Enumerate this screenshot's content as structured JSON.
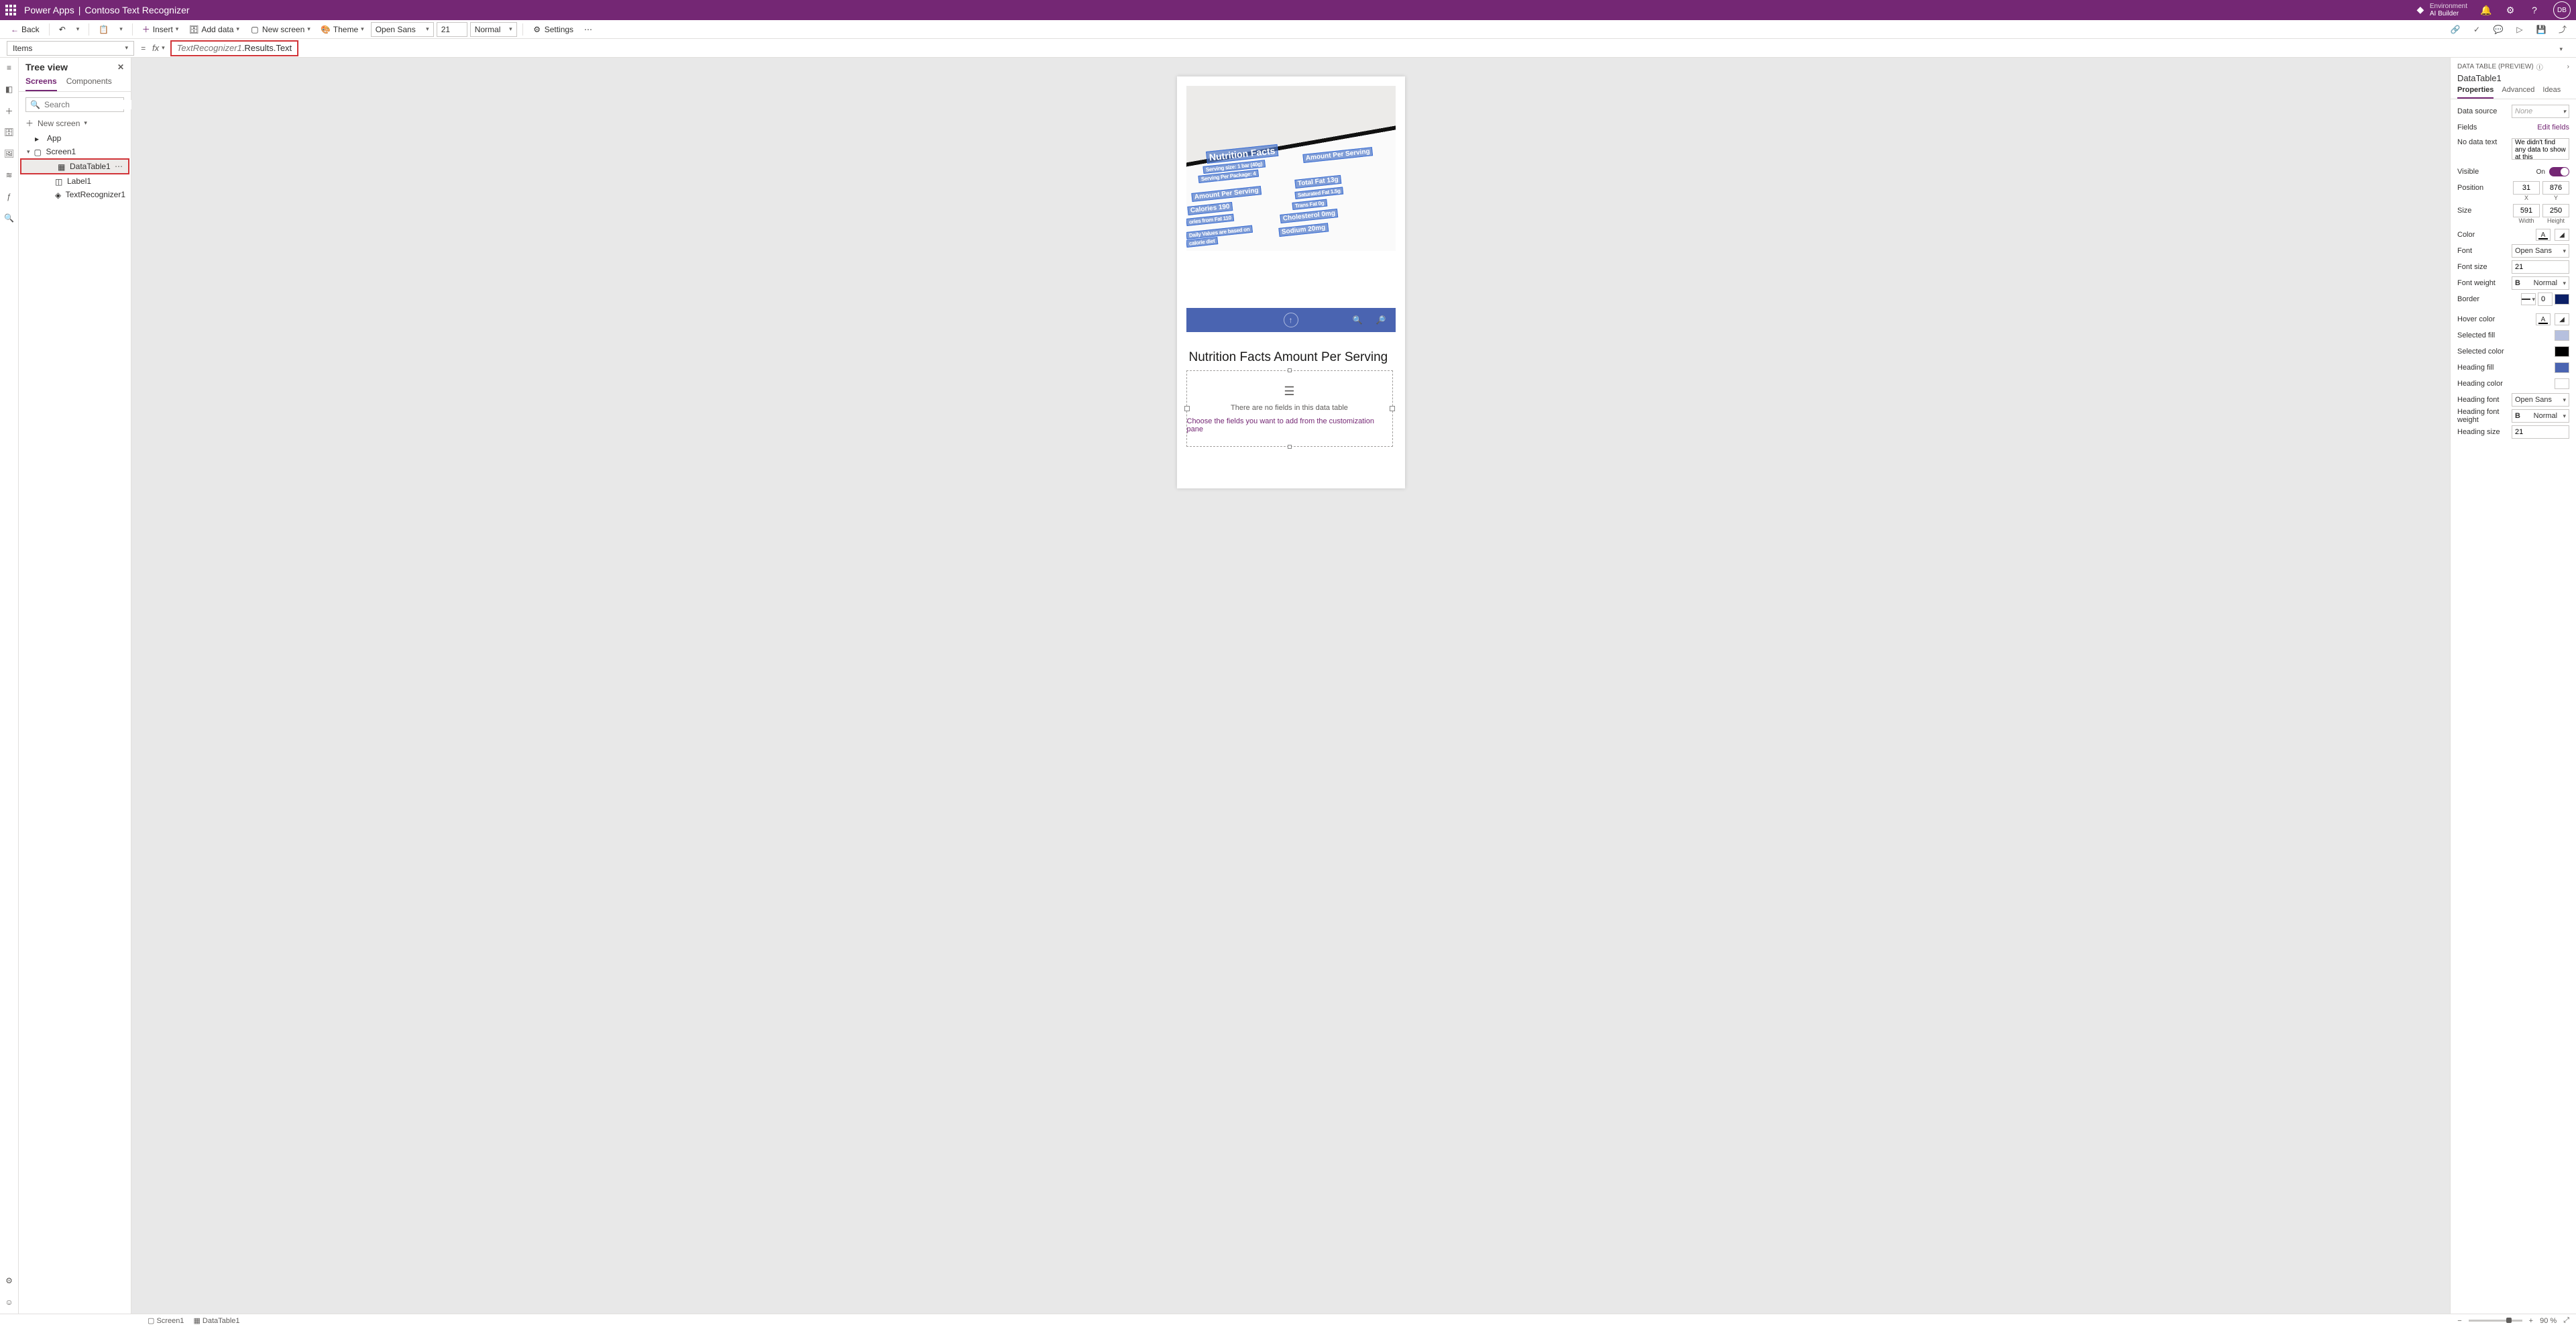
{
  "header": {
    "app_name": "Power Apps",
    "doc_name": "Contoso Text Recognizer",
    "env_label": "Environment",
    "env_value": "AI Builder",
    "avatar_initials": "DB"
  },
  "ribbon": {
    "back": "Back",
    "insert": "Insert",
    "add_data": "Add data",
    "new_screen": "New screen",
    "theme": "Theme",
    "font_family": "Open Sans",
    "font_size": "21",
    "font_weight": "Normal",
    "settings": "Settings"
  },
  "formula": {
    "property": "Items",
    "expr_obj": "TextRecognizer1",
    "expr_tail": ".Results.Text"
  },
  "tree": {
    "title": "Tree view",
    "tab_screens": "Screens",
    "tab_components": "Components",
    "search_placeholder": "Search",
    "new_screen": "New screen",
    "app": "App",
    "screen1": "Screen1",
    "datatable1": "DataTable1",
    "label1": "Label1",
    "textrecognizer1": "TextRecognizer1"
  },
  "canvas": {
    "recognized_labels": {
      "nf": "Nutrition Facts",
      "aps_top": "Amount Per Serving",
      "serving_size": "Serving size: 1 bar (40g)",
      "serving_per_pkg": "Serving Per Package: 4",
      "aps_left": "Amount Per Serving",
      "calories": "Calories 190",
      "from_fat": "ories from Fat 110",
      "daily_values": "Daily Values are based on",
      "calorie_diet": "calorie diet",
      "total_fat": "Total Fat 13g",
      "sat_fat": "Saturated Fat 1.5g",
      "trans_fat": "Trans Fat 0g",
      "cholesterol": "Cholesterol 0mg",
      "sodium": "Sodium 20mg"
    },
    "label_text": "Nutrition Facts Amount Per Serving",
    "datatable_empty_line1": "There are no fields in this data table",
    "datatable_empty_line2": "Choose the fields you want to add from the customization pane"
  },
  "props": {
    "heading": "DATA TABLE (PREVIEW)",
    "element_name": "DataTable1",
    "tab_properties": "Properties",
    "tab_advanced": "Advanced",
    "tab_ideas": "Ideas",
    "data_source_label": "Data source",
    "data_source_value": "None",
    "fields_label": "Fields",
    "edit_fields": "Edit fields",
    "no_data_label": "No data text",
    "no_data_value": "We didn't find any data to show at this",
    "visible_label": "Visible",
    "visible_on": "On",
    "position_label": "Position",
    "pos_x": "31",
    "pos_y": "876",
    "pos_x_lbl": "X",
    "pos_y_lbl": "Y",
    "size_label": "Size",
    "size_w": "591",
    "size_h": "250",
    "size_w_lbl": "Width",
    "size_h_lbl": "Height",
    "color_label": "Color",
    "font_label": "Font",
    "font_value": "Open Sans",
    "font_size_label": "Font size",
    "font_size_value": "21",
    "font_weight_label": "Font weight",
    "font_weight_value": "Normal",
    "border_label": "Border",
    "border_value": "0",
    "border_color": "#0b1f66",
    "hover_color_label": "Hover color",
    "selected_fill_label": "Selected fill",
    "selected_fill_color": "#b6c0de",
    "selected_color_label": "Selected color",
    "selected_color": "#000000",
    "heading_fill_label": "Heading fill",
    "heading_fill_color": "#4a64b1",
    "heading_color_label": "Heading color",
    "heading_font_label": "Heading font",
    "heading_font_value": "Open Sans",
    "heading_weight_label": "Heading font weight",
    "heading_weight_value": "Normal",
    "heading_size_label": "Heading size",
    "heading_size_value": "21"
  },
  "footer": {
    "screen": "Screen1",
    "datatable": "DataTable1",
    "zoom": "90 %"
  }
}
